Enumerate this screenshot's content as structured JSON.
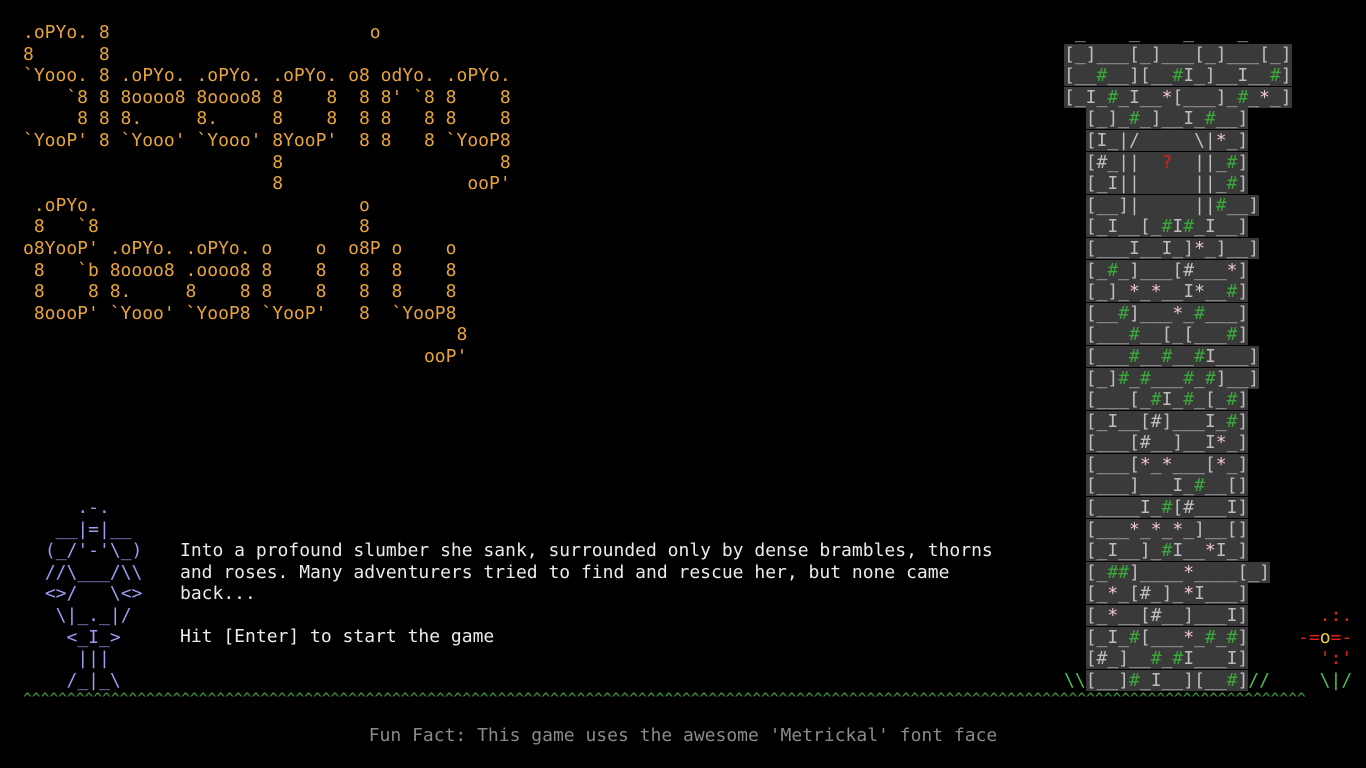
{
  "title_art": ".oPYo. 8                        o\n8      8\n`Yooo. 8 .oPYo. .oPYo. .oPYo. o8 odYo. .oPYo.\n    `8 8 8oooo8 8oooo8 8    8  8 8' `8 8    8\n     8 8 8.     8.     8    8  8 8   8 8    8\n`YooP' 8 `Yooo' `Yooo' 8YooP'  8 8   8 `YooP8\n                       8                    8\n                       8                 ooP'\n .oPYo.                        o\n 8   `8                        8\no8YooP' .oPYo. .oPYo. o    o  o8P o    o\n 8   `b 8oooo8 .oooo8 8    8   8  8    8\n 8    8 8.     8    8 8    8   8  8    8\n 8oooP' `Yooo' `YooP8 `YooP'   8  `YooP8\n                                        8\n                                     ooP'",
  "knight_art": "    .-.\n  __|=|__\n (_/'-'\\_)\n //\\___/\\\\\n <>/   \\<>\n  \\|_._|/\n   <_I_>\n    |||\n   /_|_\\",
  "story": {
    "line1": "Into a profound slumber she sank, surrounded only by dense brambles, thorns",
    "line2": "and roses. Many adventurers tried to find and rescue her, but none came",
    "line3": "back...",
    "prompt": "Hit [Enter] to start the game"
  },
  "tower": {
    "battlement": " _    _    _    _ ",
    "window_glyph": "?",
    "rows": [
      [
        {
          "t": "[_]___[_]___[_]___[_]"
        }
      ],
      [
        {
          "t": "[__"
        },
        {
          "t": "#",
          "c": "g"
        },
        {
          "t": "__][__"
        },
        {
          "t": "#",
          "c": "g"
        },
        {
          "t": "I_]__I__"
        },
        {
          "t": "#",
          "c": "g"
        },
        {
          "t": "]"
        }
      ],
      [
        {
          "t": "[_I_"
        },
        {
          "t": "#",
          "c": "g"
        },
        {
          "t": "_I__"
        },
        {
          "t": "*",
          "c": "p"
        },
        {
          "t": "[___]_"
        },
        {
          "t": "#",
          "c": "g"
        },
        {
          "t": "_"
        },
        {
          "t": "*",
          "c": "p"
        },
        {
          "t": "_]"
        }
      ]
    ],
    "shaft_rows": [
      [
        {
          "t": "[_]_"
        },
        {
          "t": "#",
          "c": "g"
        },
        {
          "t": "_]__I_"
        },
        {
          "t": "#",
          "c": "g"
        },
        {
          "t": "__]"
        }
      ],
      [
        {
          "t": "[I_|/"
        },
        {
          "t": "     "
        },
        {
          "t": "\\|"
        },
        {
          "t": "*",
          "c": "p"
        },
        {
          "t": "_]"
        }
      ],
      [
        {
          "t": "[#_||"
        },
        {
          "t": "  ? ",
          "c": "r"
        },
        {
          "t": " "
        },
        {
          "t": "||_"
        },
        {
          "t": "#",
          "c": "g"
        },
        {
          "t": "]"
        }
      ],
      [
        {
          "t": "[_I||"
        },
        {
          "t": "     "
        },
        {
          "t": "||_"
        },
        {
          "t": "#",
          "c": "g"
        },
        {
          "t": "]"
        }
      ],
      [
        {
          "t": "[__]|"
        },
        {
          "t": "     "
        },
        {
          "t": "||"
        },
        {
          "t": "#",
          "c": "g"
        },
        {
          "t": "__]"
        }
      ],
      [
        {
          "t": "[_I__[_"
        },
        {
          "t": "#",
          "c": "g"
        },
        {
          "t": "I"
        },
        {
          "t": "#",
          "c": "g"
        },
        {
          "t": "_I__]"
        }
      ],
      [
        {
          "t": "[___I__I_]"
        },
        {
          "t": "*",
          "c": "p"
        },
        {
          "t": "_]__]"
        }
      ],
      [
        {
          "t": "[_"
        },
        {
          "t": "#",
          "c": "g"
        },
        {
          "t": "_]___[#___"
        },
        {
          "t": "*",
          "c": "p"
        },
        {
          "t": "]"
        }
      ],
      [
        {
          "t": "[_]_"
        },
        {
          "t": "*",
          "c": "p"
        },
        {
          "t": "_"
        },
        {
          "t": "*",
          "c": "p"
        },
        {
          "t": "__I"
        },
        {
          "t": "*",
          "c": "p"
        },
        {
          "t": "__"
        },
        {
          "t": "#",
          "c": "g"
        },
        {
          "t": "]"
        }
      ],
      [
        {
          "t": "[__"
        },
        {
          "t": "#",
          "c": "g"
        },
        {
          "t": "]___"
        },
        {
          "t": "*",
          "c": "p"
        },
        {
          "t": "_"
        },
        {
          "t": "#",
          "c": "g"
        },
        {
          "t": "___]"
        }
      ],
      [
        {
          "t": "[___"
        },
        {
          "t": "#",
          "c": "g"
        },
        {
          "t": "__[_[___"
        },
        {
          "t": "#",
          "c": "g"
        },
        {
          "t": "]"
        }
      ],
      [
        {
          "t": "[___"
        },
        {
          "t": "#",
          "c": "g"
        },
        {
          "t": "__"
        },
        {
          "t": "#",
          "c": "g"
        },
        {
          "t": "__"
        },
        {
          "t": "#",
          "c": "g"
        },
        {
          "t": "I___]"
        }
      ],
      [
        {
          "t": "[_]"
        },
        {
          "t": "#",
          "c": "g"
        },
        {
          "t": "_"
        },
        {
          "t": "#",
          "c": "g"
        },
        {
          "t": "___"
        },
        {
          "t": "#",
          "c": "g"
        },
        {
          "t": "_"
        },
        {
          "t": "#",
          "c": "g"
        },
        {
          "t": "]__]"
        }
      ],
      [
        {
          "t": "[___[_"
        },
        {
          "t": "#",
          "c": "g"
        },
        {
          "t": "I_"
        },
        {
          "t": "#",
          "c": "g"
        },
        {
          "t": "_[_"
        },
        {
          "t": "#",
          "c": "g"
        },
        {
          "t": "]"
        }
      ],
      [
        {
          "t": "[_I__[#]___I_"
        },
        {
          "t": "#",
          "c": "g"
        },
        {
          "t": "]"
        }
      ],
      [
        {
          "t": "[___[#__]__I"
        },
        {
          "t": "*",
          "c": "p"
        },
        {
          "t": "_]"
        }
      ],
      [
        {
          "t": "[___["
        },
        {
          "t": "*",
          "c": "p"
        },
        {
          "t": "_"
        },
        {
          "t": "*",
          "c": "p"
        },
        {
          "t": "___["
        },
        {
          "t": "*",
          "c": "p"
        },
        {
          "t": "_]"
        }
      ],
      [
        {
          "t": "[___]___I_"
        },
        {
          "t": "#",
          "c": "g"
        },
        {
          "t": "__[]"
        }
      ],
      [
        {
          "t": "[____I_"
        },
        {
          "t": "#",
          "c": "g"
        },
        {
          "t": "[#___I]"
        }
      ],
      [
        {
          "t": "[___"
        },
        {
          "t": "*",
          "c": "p"
        },
        {
          "t": "_"
        },
        {
          "t": "*",
          "c": "p"
        },
        {
          "t": "_"
        },
        {
          "t": "*",
          "c": "p"
        },
        {
          "t": "_]__[]"
        }
      ],
      [
        {
          "t": "[_I__]_"
        },
        {
          "t": "#",
          "c": "g"
        },
        {
          "t": "I__"
        },
        {
          "t": "*",
          "c": "p"
        },
        {
          "t": "I_]"
        }
      ],
      [
        {
          "t": "[_"
        },
        {
          "t": "##",
          "c": "g"
        },
        {
          "t": "]____"
        },
        {
          "t": "*",
          "c": "p"
        },
        {
          "t": "____[_]"
        }
      ],
      [
        {
          "t": "[_"
        },
        {
          "t": "*",
          "c": "p"
        },
        {
          "t": "_[#_]_"
        },
        {
          "t": "*",
          "c": "p"
        },
        {
          "t": "I___]"
        }
      ],
      [
        {
          "t": "[_"
        },
        {
          "t": "*",
          "c": "p"
        },
        {
          "t": "__[#__]___I]"
        }
      ],
      [
        {
          "t": "[_I_"
        },
        {
          "t": "#",
          "c": "g"
        },
        {
          "t": "[___"
        },
        {
          "t": "*",
          "c": "p"
        },
        {
          "t": "_"
        },
        {
          "t": "#",
          "c": "g"
        },
        {
          "t": "_"
        },
        {
          "t": "#",
          "c": "g"
        },
        {
          "t": "]"
        }
      ],
      [
        {
          "t": "[#_]__"
        },
        {
          "t": "#",
          "c": "g"
        },
        {
          "t": "_"
        },
        {
          "t": "#",
          "c": "g"
        },
        {
          "t": "I___I]"
        }
      ],
      [
        {
          "t": "[__]"
        },
        {
          "t": "#",
          "c": "g"
        },
        {
          "t": "_I__][__"
        },
        {
          "t": "#",
          "c": "g"
        },
        {
          "t": "]"
        }
      ]
    ]
  },
  "grass_left": "\\\\",
  "grass_right": "//",
  "flower_art": [
    [
      {
        "t": "  .:.",
        "c": "r"
      }
    ],
    [
      {
        "t": "-=",
        "c": "r"
      },
      {
        "t": "o",
        "c": "y"
      },
      {
        "t": "=-",
        "c": "r"
      }
    ],
    [
      {
        "t": "  ':'",
        "c": "r"
      }
    ],
    [
      {
        "t": "  \\|/",
        "c": "gr"
      }
    ]
  ],
  "ground": "^^^^^^^^^^^^^^^^^^^^^^^^^^^^^^^^^^^^^^^^^^^^^^^^^^^^^^^^^^^^^^^^^^^^^^^^^^^^^^^^^^^^^^^^^^^^^^^^^^^^^^^^^^^^^^^^^^^^^^^^^^^^^^^^^^^^^^^^^^^^^^^^^^",
  "fun_fact": "Fun Fact: This game uses the awesome 'Metrickal' font face",
  "colors": {
    "title": "#e8a43c",
    "knight": "#9c9cf4",
    "grass": "#3aa83a",
    "brick_bg": "#3a3a3a",
    "rose": "#f4c8d8",
    "window_mark": "#e0201c"
  }
}
